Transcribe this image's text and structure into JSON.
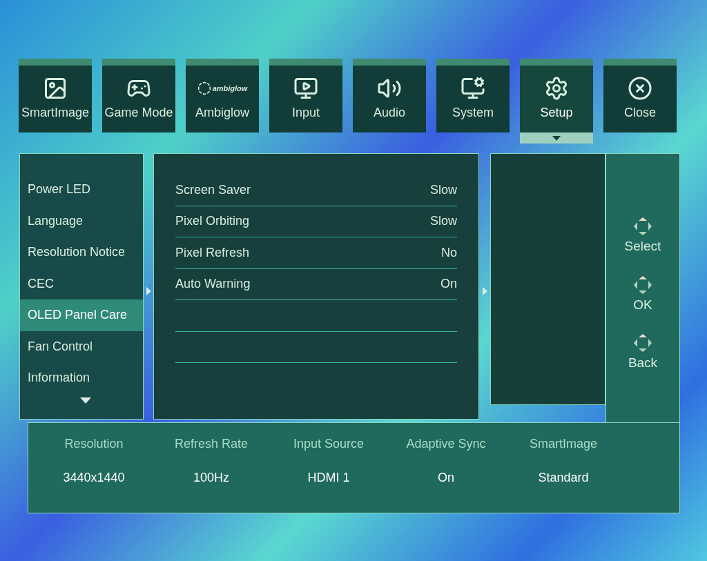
{
  "tabs": [
    {
      "kind": "smartimage",
      "label": "SmartImage",
      "selected": false
    },
    {
      "kind": "game",
      "label": "Game Mode",
      "selected": false
    },
    {
      "kind": "ambiglow",
      "label": "Ambiglow",
      "logo_text": "ambiglow",
      "selected": false
    },
    {
      "kind": "input",
      "label": "Input",
      "selected": false
    },
    {
      "kind": "audio",
      "label": "Audio",
      "selected": false
    },
    {
      "kind": "system",
      "label": "System",
      "selected": false
    },
    {
      "kind": "setup",
      "label": "Setup",
      "selected": true
    },
    {
      "kind": "close",
      "label": "Close",
      "selected": false
    }
  ],
  "menu": [
    {
      "label": "Power LED",
      "selected": false
    },
    {
      "label": "Language",
      "selected": false
    },
    {
      "label": "Resolution Notice",
      "selected": false
    },
    {
      "label": "CEC",
      "selected": false
    },
    {
      "label": "OLED Panel Care",
      "selected": true
    },
    {
      "label": "Fan Control",
      "selected": false
    },
    {
      "label": "Information",
      "selected": false
    }
  ],
  "settings": [
    {
      "label": "Screen Saver",
      "value": "Slow"
    },
    {
      "label": "Pixel Orbiting",
      "value": "Slow"
    },
    {
      "label": "Pixel Refresh",
      "value": "No"
    },
    {
      "label": "Auto Warning",
      "value": "On"
    }
  ],
  "nav_hints": [
    "Select",
    "OK",
    "Back"
  ],
  "status": [
    {
      "label": "Resolution",
      "value": "3440x1440"
    },
    {
      "label": "Refresh Rate",
      "value": "100Hz"
    },
    {
      "label": "Input Source",
      "value": "HDMI 1"
    },
    {
      "label": "Adaptive Sync",
      "value": "On"
    },
    {
      "label": "SmartImage",
      "value": "Standard"
    }
  ]
}
